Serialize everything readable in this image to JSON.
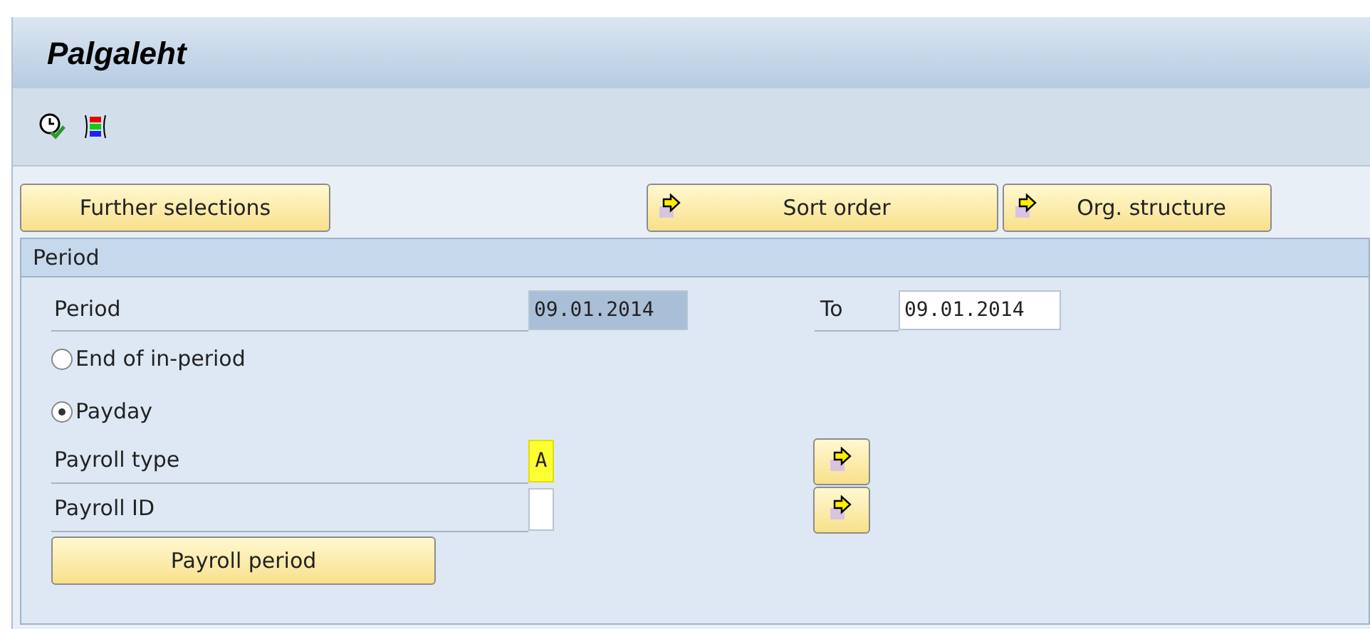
{
  "window": {
    "title": "Palgaleht"
  },
  "toolbar": [
    {
      "kind": "execute"
    },
    {
      "kind": "variants"
    }
  ],
  "top_buttons": [
    {
      "label": "Further selections",
      "arrow": false
    },
    {
      "label": "Sort order",
      "arrow": true
    },
    {
      "label": "Org. structure",
      "arrow": true
    }
  ],
  "section": {
    "title": "Period",
    "period": {
      "label": "Period",
      "from": {
        "value": "09.01.2014",
        "selected": true
      },
      "to_label": "To",
      "to": {
        "value": "09.01.2014",
        "selected": false
      }
    },
    "radios": [
      {
        "label": "End of in-period",
        "selected": false
      },
      {
        "label": "Payday",
        "selected": true
      }
    ],
    "fields": [
      {
        "label": "Payroll type",
        "value": "A",
        "focused": true,
        "arrow": true
      },
      {
        "label": "Payroll ID",
        "focused": false,
        "arrow": true
      }
    ],
    "button": {
      "label": "Payroll period"
    }
  }
}
